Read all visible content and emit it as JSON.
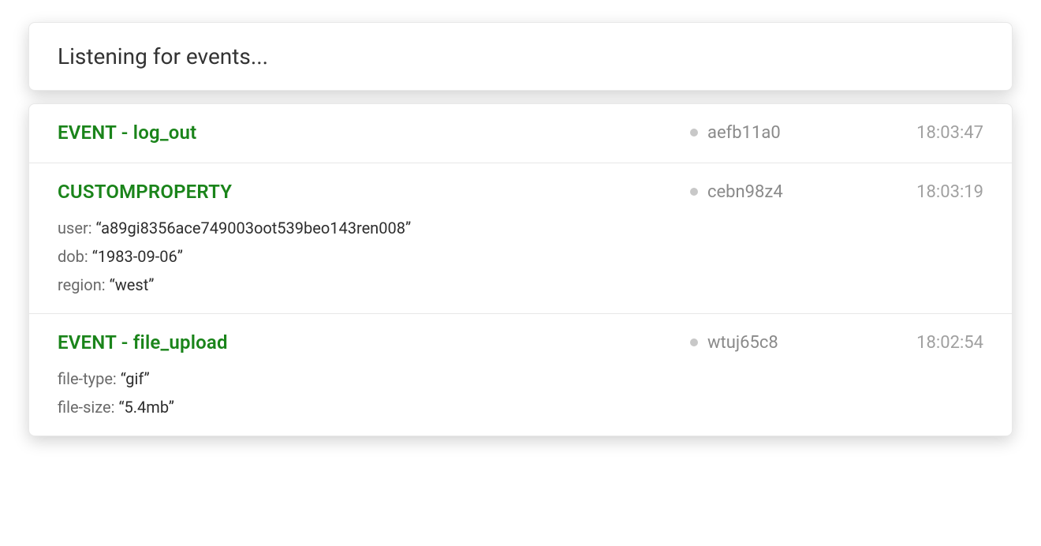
{
  "header": {
    "title": "Listening for events..."
  },
  "labels": {
    "event_prefix": "EVENT",
    "event_separator": "  -  "
  },
  "events": [
    {
      "type": "EVENT",
      "name": "log_out",
      "title_full": "EVENT  -  log_out",
      "id": "aefb11a0",
      "time": "18:03:47",
      "props": []
    },
    {
      "type": "CUSTOMPROPERTY",
      "name": "",
      "title_full": "CUSTOMPROPERTY",
      "id": "cebn98z4",
      "time": "18:03:19",
      "props": [
        {
          "key": "user",
          "value": "a89gi8356ace749003oot539beo143ren008"
        },
        {
          "key": "dob",
          "value": "1983-09-06"
        },
        {
          "key": "region",
          "value": "west"
        }
      ]
    },
    {
      "type": "EVENT",
      "name": "file_upload",
      "title_full": "EVENT  -  file_upload",
      "id": "wtuj65c8",
      "time": "18:02:54",
      "props": [
        {
          "key": "file-type",
          "value": "gif"
        },
        {
          "key": "file-size",
          "value": "5.4mb"
        }
      ]
    }
  ]
}
